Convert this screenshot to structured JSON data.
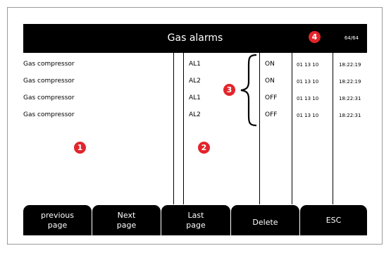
{
  "header": {
    "title": "Gas alarms",
    "counter": "64/64"
  },
  "rows": [
    {
      "name": "Gas compressor",
      "code": "AL1",
      "state": "ON",
      "date": "01 13 10",
      "time": "18:22:19"
    },
    {
      "name": "Gas compressor",
      "code": "AL2",
      "state": "ON",
      "date": "01 13 10",
      "time": "18:22:19"
    },
    {
      "name": "Gas compressor",
      "code": "AL1",
      "state": "OFF",
      "date": "01 13 10",
      "time": "18:22:31"
    },
    {
      "name": "Gas compressor",
      "code": "AL2",
      "state": "OFF",
      "date": "01 13 10",
      "time": "18:22:31"
    }
  ],
  "callouts": {
    "c1": "1",
    "c2": "2",
    "c3": "3",
    "c4": "4"
  },
  "buttons": {
    "previous": "previous\npage",
    "next": "Next\npage",
    "last": "Last\npage",
    "delete": "Delete",
    "esc": "ESC"
  },
  "colors": {
    "header_bg": "#000000",
    "callout": "#e3242b",
    "button_bg": "#000000"
  }
}
